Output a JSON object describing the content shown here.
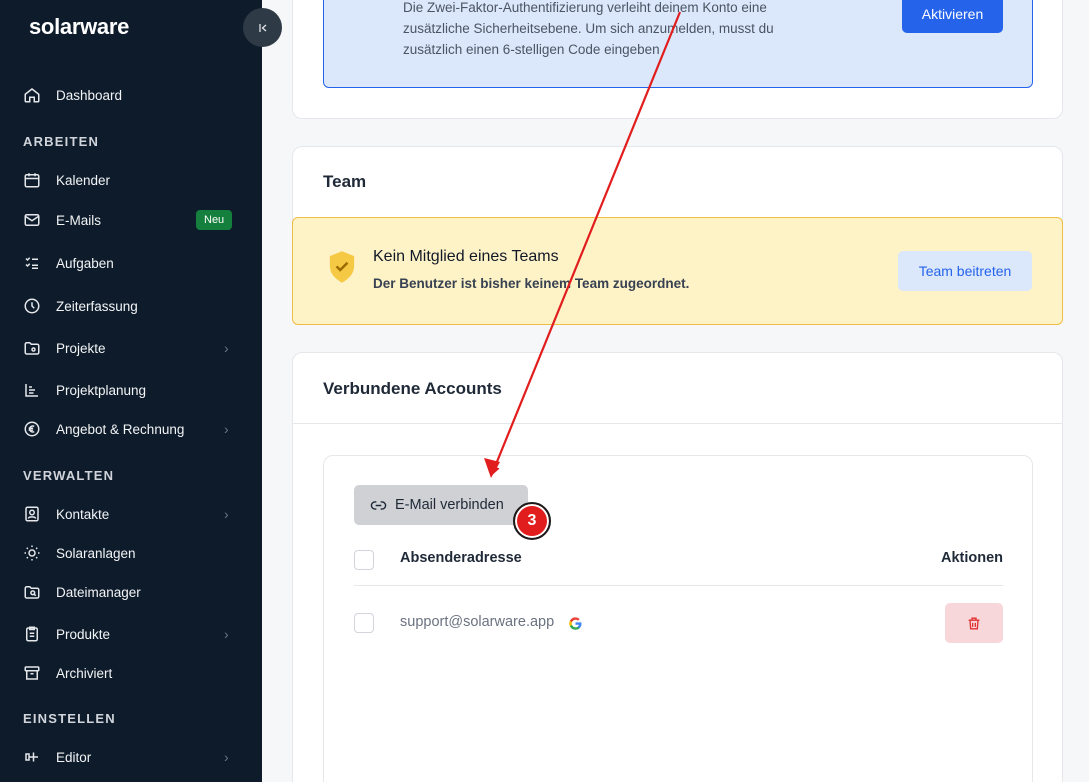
{
  "sidebar": {
    "logo": "solarware",
    "collapse_icon": "chevron-left-bar-icon",
    "items": [
      {
        "label": "Dashboard",
        "icon": "home-icon"
      },
      {
        "label": "Kalender",
        "icon": "calendar-icon"
      },
      {
        "label": "E-Mails",
        "icon": "mail-icon",
        "badge": "Neu"
      },
      {
        "label": "Aufgaben",
        "icon": "tasks-icon"
      },
      {
        "label": "Zeiterfassung",
        "icon": "clock-icon"
      },
      {
        "label": "Projekte",
        "icon": "folder-icon"
      },
      {
        "label": "Projektplanung",
        "icon": "chart-icon"
      },
      {
        "label": "Angebot & Rechnung",
        "icon": "euro-icon"
      },
      {
        "label": "Kontakte",
        "icon": "contact-icon"
      },
      {
        "label": "Solaranlagen",
        "icon": "sun-icon"
      },
      {
        "label": "Dateimanager",
        "icon": "folder-search-icon"
      },
      {
        "label": "Produkte",
        "icon": "clipboard-icon"
      },
      {
        "label": "Archiviert",
        "icon": "archive-icon"
      },
      {
        "label": "Editor",
        "icon": "editor-icon"
      }
    ],
    "sections": {
      "arbeiten": "ARBEITEN",
      "verwalten": "VERWALTEN",
      "einstellen": "EINSTELLEN"
    }
  },
  "twofa": {
    "text": "Die Zwei-Faktor-Authentifizierung verleiht deinem Konto eine zusätzliche Sicherheitsebene. Um sich anzumelden, musst du zusätzlich einen 6-stelligen Code eingeben",
    "button": "Aktivieren"
  },
  "team": {
    "title": "Team",
    "banner_title": "Kein Mitglied eines Teams",
    "banner_sub": "Der Benutzer ist bisher keinem Team zugeordnet.",
    "button": "Team beitreten"
  },
  "accounts": {
    "title": "Verbundene Accounts",
    "connect_button": "E-Mail verbinden",
    "step_badge": "3",
    "columns": {
      "sender": "Absenderadresse",
      "actions": "Aktionen"
    },
    "rows": [
      {
        "email": "support@solarware.app",
        "provider_icon": "google-icon"
      }
    ]
  },
  "colors": {
    "sidebar_bg": "#0d1b2a",
    "primary": "#2563eb",
    "annotation_red": "#e11d1d"
  }
}
